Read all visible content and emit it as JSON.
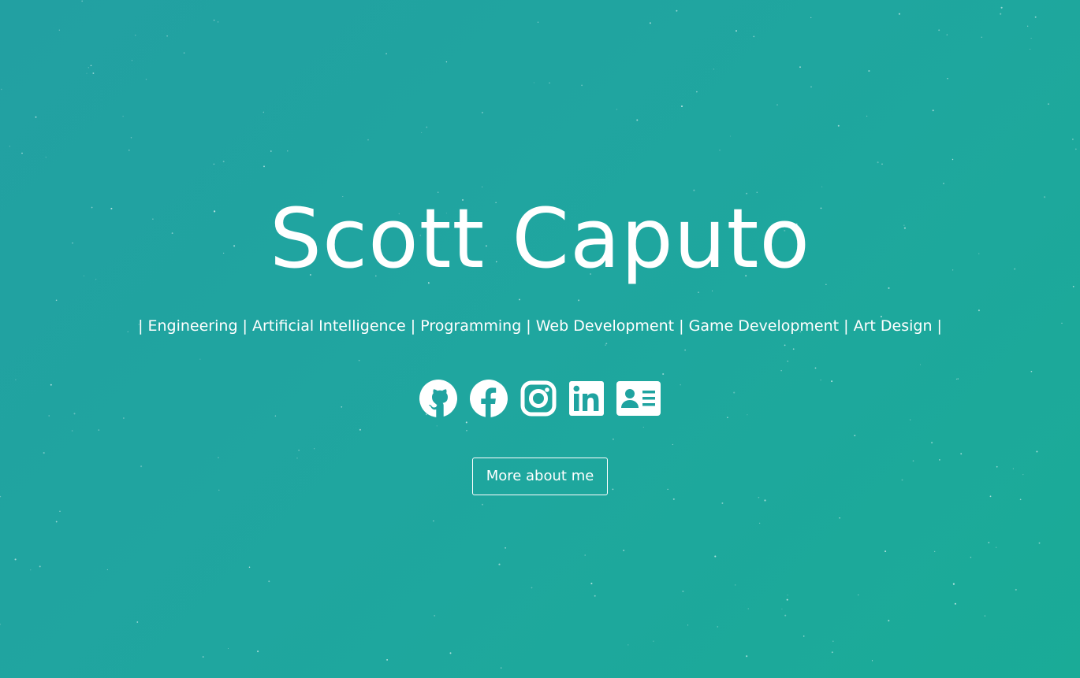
{
  "hero": {
    "name": "Scott Caputo",
    "tagline": "| Engineering | Artificial Intelligence | Programming | Web Development | Game Development | Art Design |"
  },
  "social_links": [
    {
      "name": "github",
      "icon": "github-icon"
    },
    {
      "name": "facebook",
      "icon": "facebook-icon"
    },
    {
      "name": "instagram",
      "icon": "instagram-icon"
    },
    {
      "name": "linkedin",
      "icon": "linkedin-icon"
    },
    {
      "name": "contact-card",
      "icon": "contact-card-icon"
    }
  ],
  "cta": {
    "label": "More about me"
  },
  "colors": {
    "background_start": "#22a0a2",
    "background_end": "#1aab97",
    "text": "#ffffff"
  }
}
